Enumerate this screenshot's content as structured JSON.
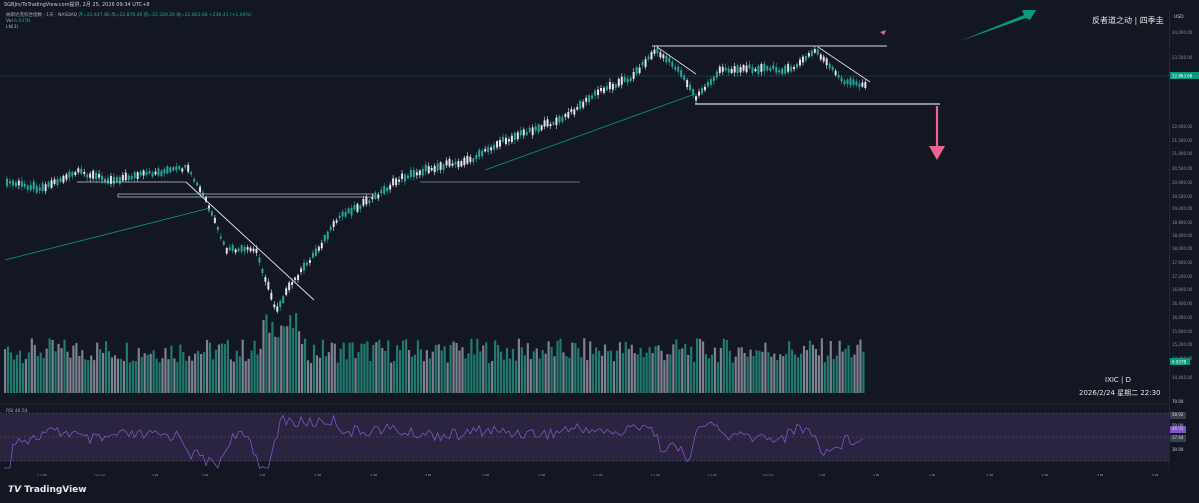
{
  "topbar": {
    "text": "SGBJin/ToTradingView.com提供, 2月 25, 2026 09:34 UTC+8"
  },
  "legend": {
    "title": "纳斯达克综合指数 · 1天 · NASDAQ",
    "ohlc": "开=22,447.80 高=22,876.46 低=22,328.26 收=22,863.68 +236.41 (+1.04%)",
    "vol_label": "Vol",
    "vol_value": "6.037B",
    "extra": "LN(3)"
  },
  "watermark": {
    "top_right": "反者道之动 | 四季圭",
    "symbol": "IXIC | D",
    "datetime": "2026/2/24 星期二 22:30"
  },
  "price_axis": {
    "currency": "USD",
    "ticks": [
      "24,000.00",
      "23,500.00",
      "22,863.68",
      "22,000.00",
      "21,500.00",
      "21,000.00",
      "20,500.00",
      "20,000.00",
      "19,500.00",
      "19,200.00",
      "18,800.00",
      "18,400.00",
      "18,000.00",
      "17,600.00",
      "17,200.00",
      "16,800.00",
      "16,400.00",
      "16,000.00",
      "15,600.00",
      "15,200.00",
      "14,800.00",
      "14,405.00"
    ],
    "last_price": "22,863.68",
    "volume_badge": "6.037B"
  },
  "rsi": {
    "label": "RSI",
    "value": "46.54",
    "ticks": [
      "70.00",
      "58.92",
      "50.00",
      "46.54",
      "37.64",
      "30.00"
    ]
  },
  "time_axis": {
    "labels": [
      "12月",
      "2025",
      "2月",
      "3月",
      "4月",
      "5月",
      "6月",
      "7月",
      "8月",
      "9月",
      "10月",
      "11月",
      "12月",
      "2026",
      "2月",
      "3月",
      "4月",
      "5月",
      "6月",
      "7月",
      "8月"
    ]
  },
  "bottombar": {
    "logo_text": "TradingView"
  },
  "colors": {
    "bg": "#131722",
    "up": "#26a69a",
    "down": "#e0e3eb",
    "accent_green": "#089981",
    "arrow_pink": "#f06292",
    "rsi_line": "#7e57c2",
    "rsi_fill": "#2a2440"
  }
}
